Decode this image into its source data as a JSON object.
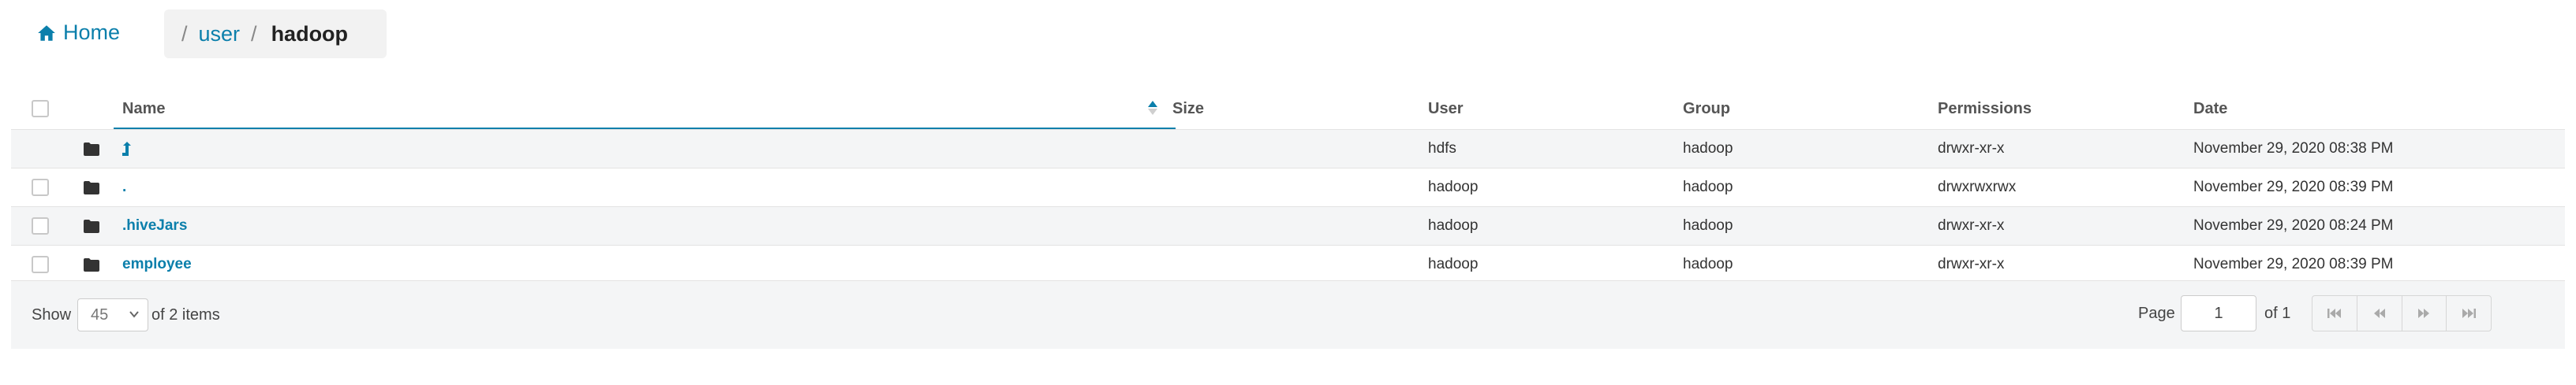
{
  "nav": {
    "home_label": "Home",
    "breadcrumb": {
      "separator": "/",
      "parent": "user",
      "current": "hadoop"
    }
  },
  "table": {
    "columns": {
      "name": "Name",
      "size": "Size",
      "user": "User",
      "group": "Group",
      "permissions": "Permissions",
      "date": "Date"
    },
    "sort": {
      "column": "Name",
      "direction": "ascending"
    },
    "rows": [
      {
        "name": "",
        "is_parent_link": true,
        "size": "",
        "user": "hdfs",
        "group": "hadoop",
        "permissions": "drwxr-xr-x",
        "date": "November 29, 2020 08:38 PM"
      },
      {
        "name": ".",
        "size": "",
        "user": "hadoop",
        "group": "hadoop",
        "permissions": "drwxrwxrwx",
        "date": "November 29, 2020 08:39 PM"
      },
      {
        "name": ".hiveJars",
        "size": "",
        "user": "hadoop",
        "group": "hadoop",
        "permissions": "drwxr-xr-x",
        "date": "November 29, 2020 08:24 PM"
      },
      {
        "name": "employee",
        "size": "",
        "user": "hadoop",
        "group": "hadoop",
        "permissions": "drwxr-xr-x",
        "date": "November 29, 2020 08:39 PM"
      }
    ]
  },
  "footer": {
    "show_label": "Show",
    "page_size": "45",
    "items_label": "of 2 items",
    "page_label": "Page",
    "page_value": "1",
    "of_pages_label": "of 1"
  },
  "colors": {
    "link": "#0b7fab",
    "stripe": "#f4f5f6",
    "folder_icon": "#333333"
  },
  "icons": {
    "home": "home-icon",
    "folder": "folder-icon",
    "parent": "up-arrow-icon",
    "sort": "sort-asc-icon",
    "first": "first-page-icon",
    "prev": "prev-page-icon",
    "next": "next-page-icon",
    "last": "last-page-icon"
  }
}
